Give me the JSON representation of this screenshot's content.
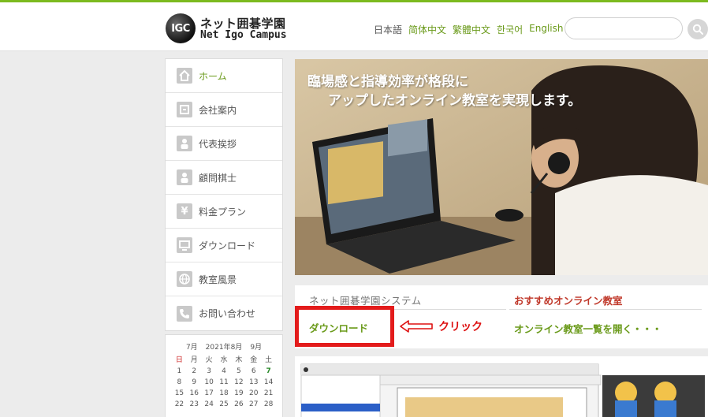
{
  "header": {
    "logo_mark": "IGC",
    "logo_title_jp": "ネット囲碁学園",
    "logo_title_en": "Net Igo Campus",
    "languages": [
      {
        "label": "日本語",
        "current": true
      },
      {
        "label": "简体中文",
        "current": false
      },
      {
        "label": "繁體中文",
        "current": false
      },
      {
        "label": "한국어",
        "current": false
      },
      {
        "label": "English",
        "current": false
      }
    ],
    "search": {
      "value": "",
      "placeholder": "",
      "icon": "search-icon"
    }
  },
  "sidebar": {
    "items": [
      {
        "label": "ホーム",
        "icon": "home-icon",
        "active": true
      },
      {
        "label": "会社案内",
        "icon": "company-icon",
        "active": false
      },
      {
        "label": "代表挨拶",
        "icon": "person-icon",
        "active": false
      },
      {
        "label": "顧問棋士",
        "icon": "person-icon",
        "active": false
      },
      {
        "label": "料金プラン",
        "icon": "yen-icon",
        "active": false
      },
      {
        "label": "ダウンロード",
        "icon": "monitor-icon",
        "active": false
      },
      {
        "label": "教室風景",
        "icon": "globe-icon",
        "active": false
      },
      {
        "label": "お問い合わせ",
        "icon": "phone-icon",
        "active": false
      }
    ]
  },
  "calendar": {
    "prev": "7月",
    "current": "2021年8月",
    "next": "9月",
    "weekdays": [
      "日",
      "月",
      "火",
      "水",
      "木",
      "金",
      "土"
    ],
    "days": [
      "1",
      "2",
      "3",
      "4",
      "5",
      "6",
      "7",
      "8",
      "9",
      "10",
      "11",
      "12",
      "13",
      "14",
      "15",
      "16",
      "17",
      "18",
      "19",
      "20",
      "21",
      "22",
      "23",
      "24",
      "25",
      "26",
      "27",
      "28"
    ],
    "today": "7"
  },
  "hero": {
    "line1": "臨場感と指導効率が格段に",
    "line2": "アップしたオンライン教室を実現します。"
  },
  "system_panel": {
    "title": "ネット囲碁学園システム",
    "download_link": "ダウンロード",
    "click_annotation": "クリック",
    "recommend_title": "おすすめオンライン教室",
    "recommend_link": "オンライン教室一覧を開く・・・"
  },
  "colors": {
    "accent_green": "#6a9a1a",
    "recommend_red": "#c0392b",
    "annotation_red": "#e31b1b"
  }
}
